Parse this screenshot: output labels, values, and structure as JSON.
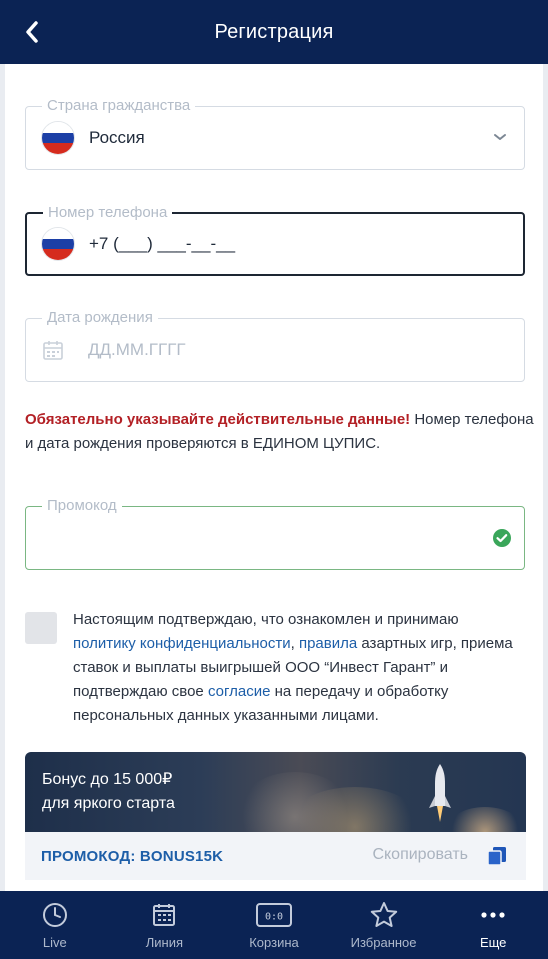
{
  "header": {
    "title": "Регистрация",
    "back_icon": "chevron-left-icon"
  },
  "form": {
    "country": {
      "label": "Страна гражданства",
      "value": "Россия",
      "flag": "russia-flag-icon"
    },
    "phone": {
      "label": "Номер телефона",
      "value": "+7 (___) ___-__-__",
      "flag": "russia-flag-icon"
    },
    "birthdate": {
      "label": "Дата рождения",
      "placeholder": "ДД.ММ.ГГГГ",
      "icon": "calendar-icon"
    },
    "promocode": {
      "label": "Промокод",
      "value": "",
      "status_icon": "check-circle-icon",
      "status_color": "#3aa65a"
    }
  },
  "warning": {
    "bold": "Обязательно указывайте действительные данные!",
    "rest": " Номер телефона и дата рождения проверяются в ЕДИНОМ ЦУПИС."
  },
  "consent": {
    "t1": "Настоящим подтверждаю, что ознакомлен и принимаю ",
    "link1": "политику конфиденциальности",
    "t2": ", ",
    "link2": "правила",
    "t3": " азартных игр, приема ставок и выплаты выигрышей ООО “Инвест Гарант” и подтверждаю свое ",
    "link3": "согласие",
    "t4": " на передачу и обработку персональных данных указанными лицами."
  },
  "banner": {
    "line1": "Бонус до 15 000₽",
    "line2": "для яркого старта",
    "promo_code": "ПРОМОКОД: BONUS15K",
    "copy_label": "Скопировать"
  },
  "nav": [
    {
      "label": "Live",
      "icon": "clock-icon"
    },
    {
      "label": "Линия",
      "icon": "calendar-icon"
    },
    {
      "label": "Корзина",
      "icon": "scoreboard-icon"
    },
    {
      "label": "Избранное",
      "icon": "star-icon"
    },
    {
      "label": "Еще",
      "icon": "more-dots-icon"
    }
  ],
  "colors": {
    "header_bg": "#0b2354",
    "accent_red": "#b32025",
    "link_blue": "#1d5ea8"
  }
}
